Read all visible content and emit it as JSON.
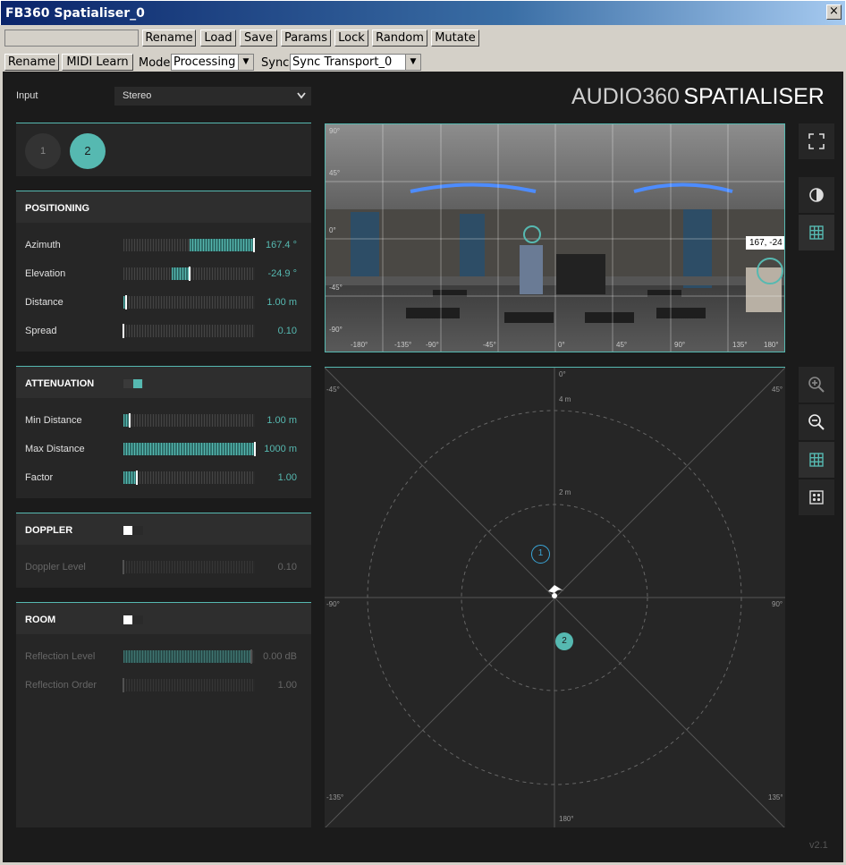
{
  "window": {
    "title": "FB360 Spatialiser_0",
    "close_label": "×"
  },
  "toolbar1": {
    "preset_value": "",
    "buttons": [
      "Rename",
      "Load",
      "Save",
      "Params",
      "Lock",
      "Random",
      "Mutate"
    ]
  },
  "toolbar2": {
    "rename": "Rename",
    "midi_learn": "MIDI Learn",
    "mode_label": "Mode",
    "mode_value": "Processing",
    "sync_label": "Sync",
    "sync_value": "Sync Transport_0"
  },
  "header": {
    "input_label": "Input",
    "input_value": "Stereo",
    "brand_audio": "AUDIO",
    "brand_360": "360",
    "brand_spatialiser": "SPATIALISER"
  },
  "sources": {
    "items": [
      "1",
      "2"
    ],
    "selected": "2"
  },
  "positioning": {
    "title": "POSITIONING",
    "params": [
      {
        "label": "Azimuth",
        "value": "167.4 °",
        "fill_from": 0.5,
        "fill_to": 0.99
      },
      {
        "label": "Elevation",
        "value": "-24.9 °",
        "fill_from": 0.37,
        "fill_to": 0.5
      },
      {
        "label": "Distance",
        "value": "1.00 m",
        "fill_from": 0.0,
        "fill_to": 0.02
      },
      {
        "label": "Spread",
        "value": "0.10",
        "fill_from": 0.0,
        "fill_to": 0.0
      }
    ]
  },
  "attenuation": {
    "title": "ATTENUATION",
    "enabled": true,
    "params": [
      {
        "label": "Min Distance",
        "value": "1.00 m",
        "fill_from": 0.0,
        "fill_to": 0.05
      },
      {
        "label": "Max Distance",
        "value": "1000 m",
        "fill_from": 0.0,
        "fill_to": 1.0
      },
      {
        "label": "Factor",
        "value": "1.00",
        "fill_from": 0.0,
        "fill_to": 0.1
      }
    ]
  },
  "doppler": {
    "title": "DOPPLER",
    "enabled": false,
    "params": [
      {
        "label": "Doppler Level",
        "value": "0.10",
        "fill_from": 0.0,
        "fill_to": 0.0
      }
    ]
  },
  "room": {
    "title": "ROOM",
    "enabled": false,
    "params": [
      {
        "label": "Reflection Level",
        "value": "0.00 dB",
        "fill_from": 0.0,
        "fill_to": 0.97
      },
      {
        "label": "Reflection Order",
        "value": "1.00",
        "fill_from": 0.0,
        "fill_to": 0.0
      }
    ]
  },
  "video": {
    "elev_labels": [
      "90°",
      "45°",
      "0°",
      "-45°",
      "-90°"
    ],
    "azim_labels": [
      "-180°",
      "-135°",
      "-90°",
      "-45°",
      "0°",
      "45°",
      "90°",
      "135°",
      "180°"
    ],
    "tooltip": "167, -24",
    "source_marker": "1"
  },
  "topview": {
    "angle_labels": {
      "front": "0°",
      "back": "180°",
      "left": "-90°",
      "right": "90°",
      "fl": "-45°",
      "fr": "45°",
      "bl": "-135°",
      "br": "135°"
    },
    "ring_labels": [
      "4 m",
      "2 m"
    ],
    "source1": "1",
    "source2": "2"
  },
  "side_icons_top": [
    "fullscreen-icon",
    "contrast-icon",
    "grid-icon"
  ],
  "side_icons_bottom": [
    "zoom-in-icon",
    "zoom-out-icon",
    "grid-icon",
    "dots-icon"
  ],
  "version": "v2.1",
  "colors": {
    "accent": "#56b9b1",
    "panel": "#262626",
    "background": "#1b1b1b"
  }
}
